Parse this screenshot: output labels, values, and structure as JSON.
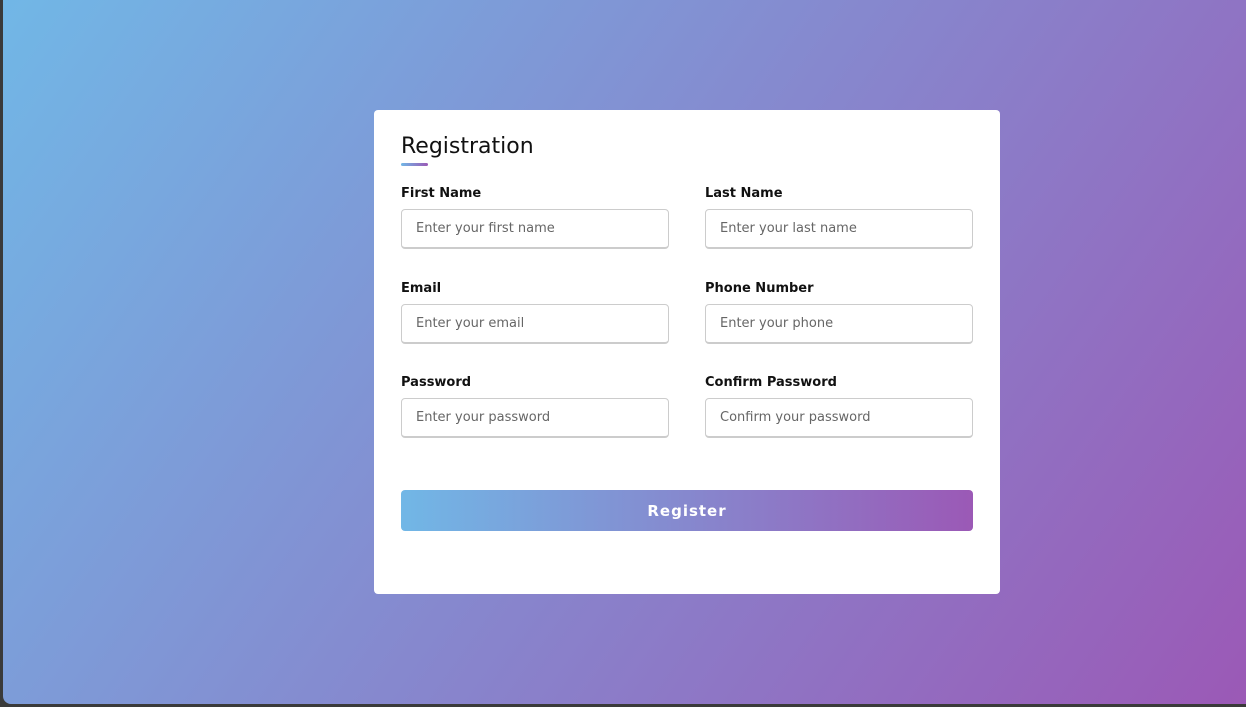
{
  "form": {
    "title": "Registration",
    "fields": [
      {
        "label": "First Name",
        "placeholder": "Enter your first name"
      },
      {
        "label": "Last Name",
        "placeholder": "Enter your last name"
      },
      {
        "label": "Email",
        "placeholder": "Enter your email"
      },
      {
        "label": "Phone Number",
        "placeholder": "Enter your phone"
      },
      {
        "label": "Password",
        "placeholder": "Enter your password"
      },
      {
        "label": "Confirm Password",
        "placeholder": "Confirm your password"
      }
    ],
    "submit_label": "Register"
  },
  "colors": {
    "gradient_start": "#71b7e6",
    "gradient_end": "#9b59b6"
  }
}
